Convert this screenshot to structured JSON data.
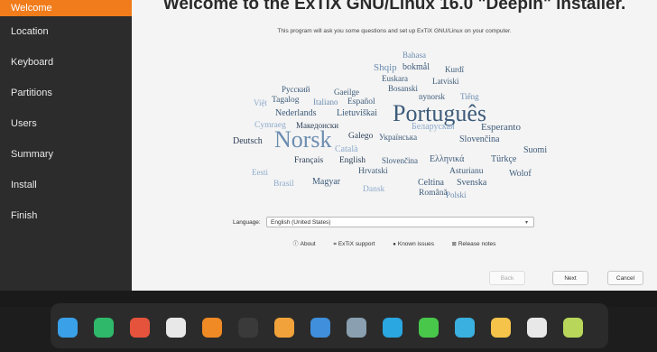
{
  "sidebar": {
    "items": [
      {
        "label": "Welcome",
        "active": true
      },
      {
        "label": "Location"
      },
      {
        "label": "Keyboard"
      },
      {
        "label": "Partitions"
      },
      {
        "label": "Users"
      },
      {
        "label": "Summary"
      },
      {
        "label": "Install"
      },
      {
        "label": "Finish"
      }
    ]
  },
  "main": {
    "title": "Welcome to the ExTiX GNU/Linux 16.0 \"Deepin\" installer.",
    "intro": "This program will ask you some questions and set up ExTiX GNU/Linux on your computer."
  },
  "language_cloud": [
    "Bahasa",
    "Shqip",
    "bokmål",
    "Kurdî",
    "Euskara",
    "Latviski",
    "Bosanski",
    "Русский",
    "Gaeilge",
    "nynorsk",
    "Tiếng",
    "Việt",
    "Tagalog",
    "Italiano",
    "Español",
    "Nederlands",
    "Lietuviškai",
    "Português",
    "Cymraeg",
    "Македонски",
    "Беларуская",
    "Esperanto",
    "Deutsch",
    "Norsk",
    "Galego",
    "Українська",
    "Slovenčina",
    "Català",
    "Suomi",
    "Français",
    "English",
    "Slovenčina",
    "Ελληνικά",
    "Türkçe",
    "Eesti",
    "Hrvatski",
    "Asturianu",
    "Wolof",
    "Brasil",
    "Magyar",
    "Celtina",
    "Svenska",
    "Dansk",
    "Română",
    "Polski"
  ],
  "language": {
    "label": "Language:",
    "selected": "English (United States)"
  },
  "links": {
    "about": "About",
    "support": "ExTiX support",
    "known_issues": "Known issues",
    "release_notes": "Release notes"
  },
  "buttons": {
    "back": "Back",
    "next": "Next",
    "cancel": "Cancel"
  },
  "dock": {
    "icons": [
      {
        "name": "launcher-icon",
        "color": "#3aa0e8"
      },
      {
        "name": "file-manager-icon",
        "color": "#2fb86a"
      },
      {
        "name": "screen-recorder-icon",
        "color": "#e5533d"
      },
      {
        "name": "settings-icon",
        "color": "#e8e8e8"
      },
      {
        "name": "firefox-icon",
        "color": "#f08a24"
      },
      {
        "name": "terminal-icon",
        "color": "#3a3a3a"
      },
      {
        "name": "install-icon",
        "color": "#f2a23a"
      },
      {
        "name": "folder-icon",
        "color": "#3f8fdc"
      },
      {
        "name": "photos-icon",
        "color": "#8aa0b0"
      },
      {
        "name": "music-icon",
        "color": "#2aa6e0"
      },
      {
        "name": "chat-icon",
        "color": "#48c74a"
      },
      {
        "name": "store-icon",
        "color": "#3ab0e0"
      },
      {
        "name": "disk-icon",
        "color": "#f5c34a"
      },
      {
        "name": "monitor-icon",
        "color": "#e8e8e8"
      },
      {
        "name": "trash-icon",
        "color": "#b8d75a"
      }
    ]
  }
}
